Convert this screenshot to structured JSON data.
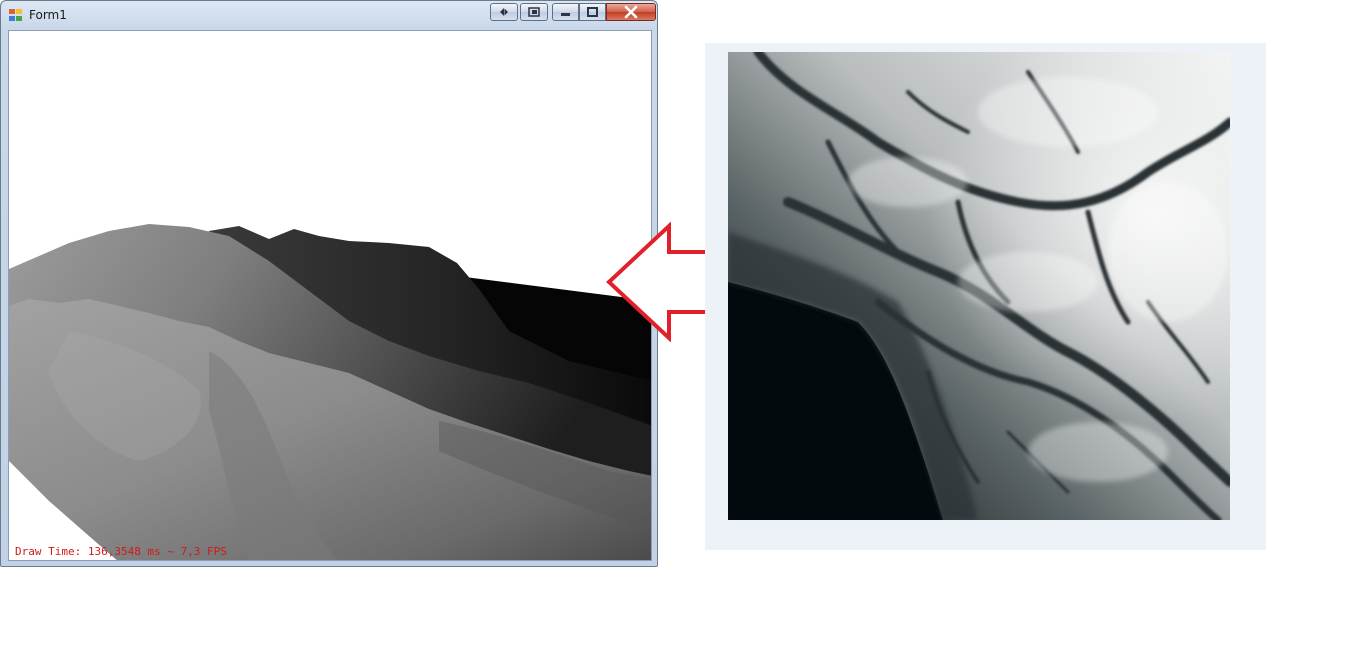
{
  "window": {
    "title": "Form1",
    "status_text": "Draw Time: 136,3548 ms ~ 7,3 FPS"
  },
  "icons": {
    "app": "app-icon",
    "nav_left_right": "nav-arrows-icon",
    "nav_dock": "dock-icon",
    "minimize": "minimize-icon",
    "maximize": "maximize-icon",
    "close": "close-icon",
    "arrow": "left-arrow-icon"
  },
  "colors": {
    "status_text": "#d11a1a",
    "arrow_stroke": "#e0202a",
    "panel_bg": "#edf1f8"
  }
}
